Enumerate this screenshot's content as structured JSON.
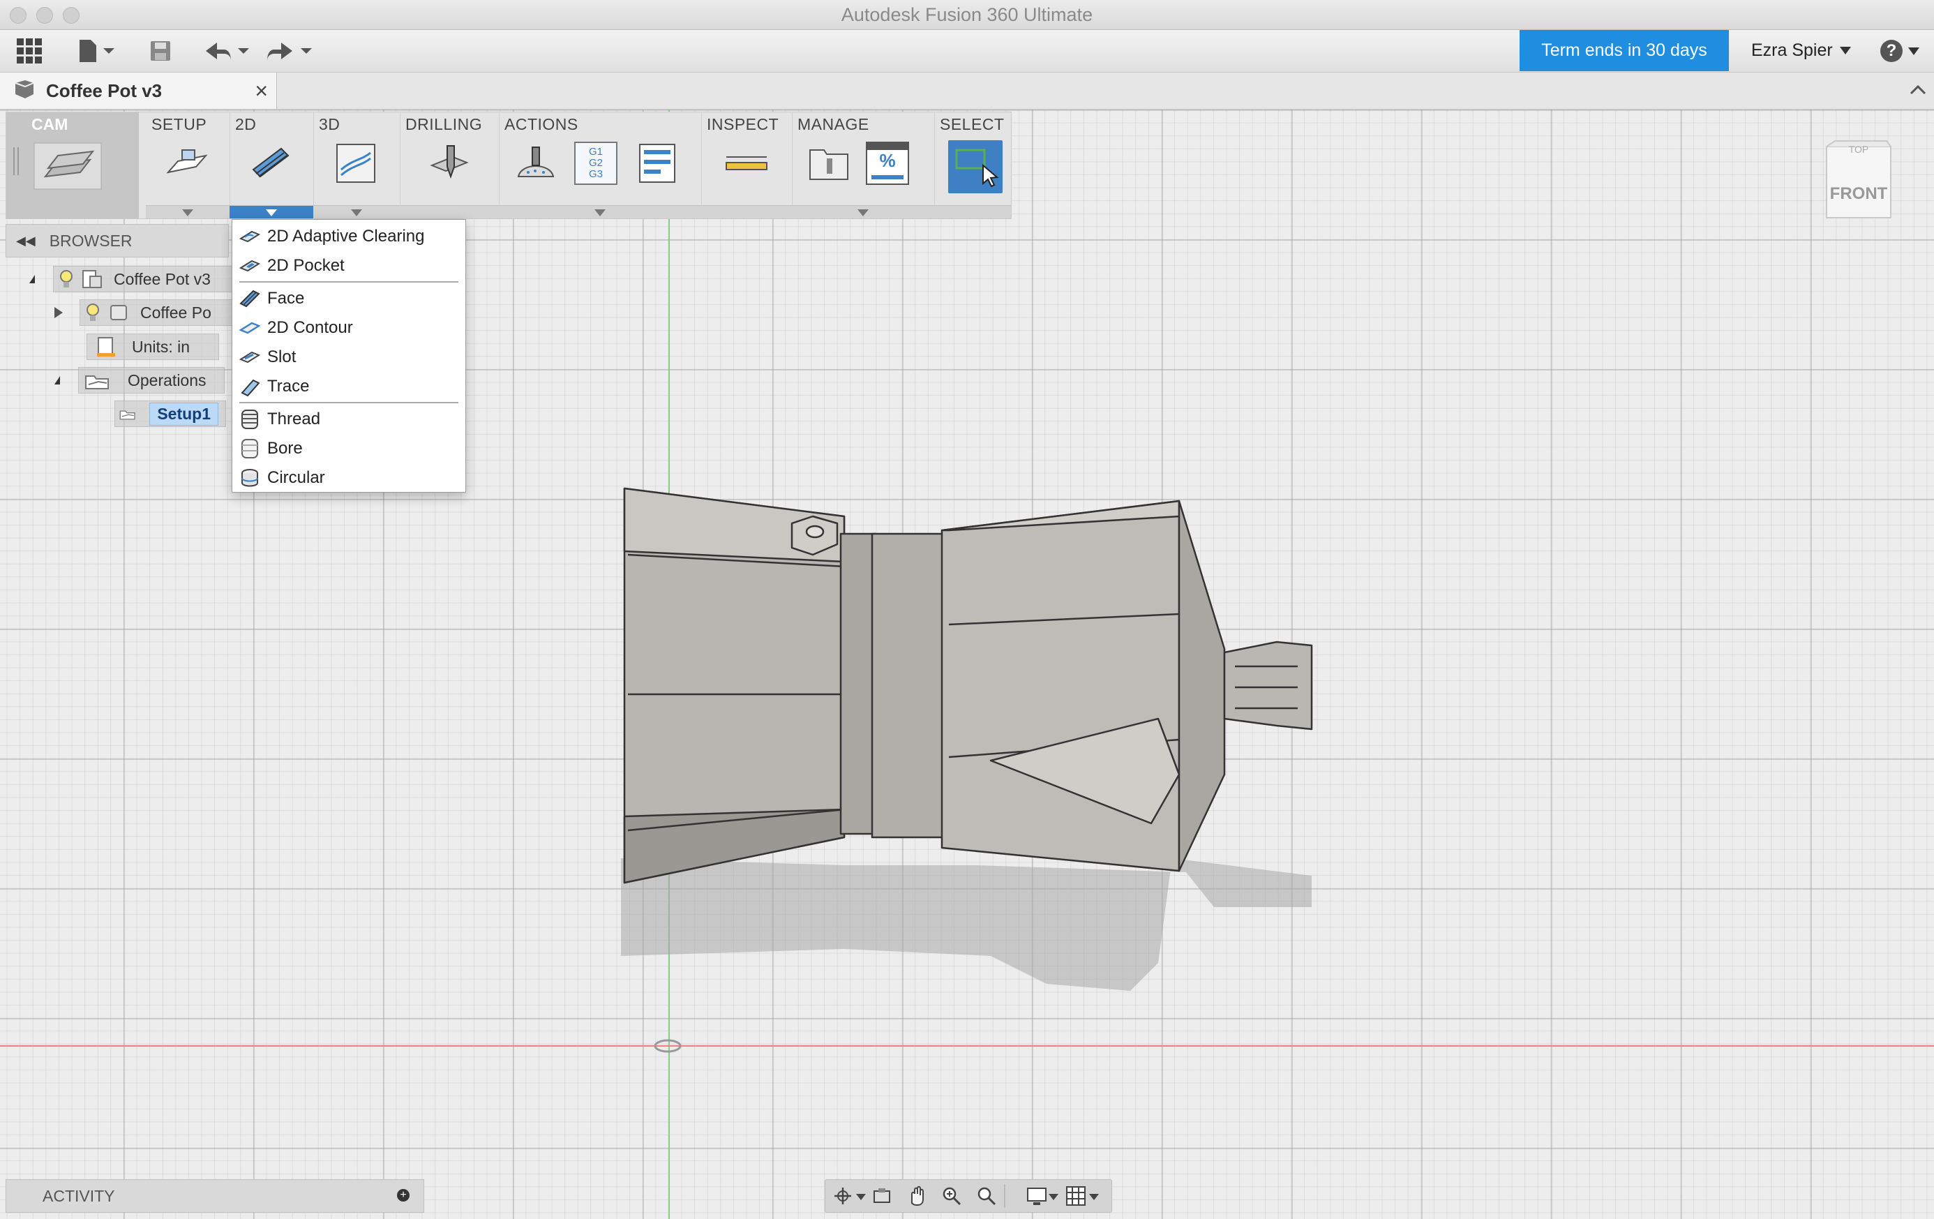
{
  "window": {
    "title": "Autodesk Fusion 360 Ultimate"
  },
  "toolbar": {
    "term_label": "Term ends in 30 days",
    "user_name": "Ezra Spier",
    "help_label": "?"
  },
  "document_tab": {
    "name": "Coffee Pot v3",
    "close_glyph": "×"
  },
  "ribbon": {
    "workspace": "CAM",
    "groups": [
      {
        "label": "SETUP"
      },
      {
        "label": "2D"
      },
      {
        "label": "3D"
      },
      {
        "label": "DRILLING"
      },
      {
        "label": "ACTIONS"
      },
      {
        "label": "INSPECT"
      },
      {
        "label": "MANAGE"
      },
      {
        "label": "SELECT"
      }
    ],
    "gcode_icon_text": [
      "G1",
      "G2",
      "G3"
    ],
    "manage_percent": "%"
  },
  "browser": {
    "title": "BROWSER",
    "tree": [
      {
        "label": "Coffee Pot v3"
      },
      {
        "label": "Coffee Po"
      },
      {
        "label": "Units: in"
      },
      {
        "label": "Operations"
      },
      {
        "label": "Setup1"
      }
    ]
  },
  "menu_2d": {
    "items": [
      {
        "label": "2D Adaptive Clearing",
        "icon": "adaptive-clearing-icon"
      },
      {
        "label": "2D Pocket",
        "icon": "pocket-icon"
      },
      {
        "label": "Face",
        "icon": "face-icon"
      },
      {
        "label": "2D Contour",
        "icon": "contour-icon"
      },
      {
        "label": "Slot",
        "icon": "slot-icon"
      },
      {
        "label": "Trace",
        "icon": "trace-icon"
      },
      {
        "label": "Thread",
        "icon": "thread-icon"
      },
      {
        "label": "Bore",
        "icon": "bore-icon"
      },
      {
        "label": "Circular",
        "icon": "circular-icon"
      }
    ]
  },
  "viewcube": {
    "top_label": "TOP",
    "front_label": "FRONT"
  },
  "activity": {
    "title": "ACTIVITY"
  },
  "colors": {
    "accent": "#1f8ee0",
    "ribbon_active": "#3c82c8",
    "selection": "#bcd9f6"
  }
}
